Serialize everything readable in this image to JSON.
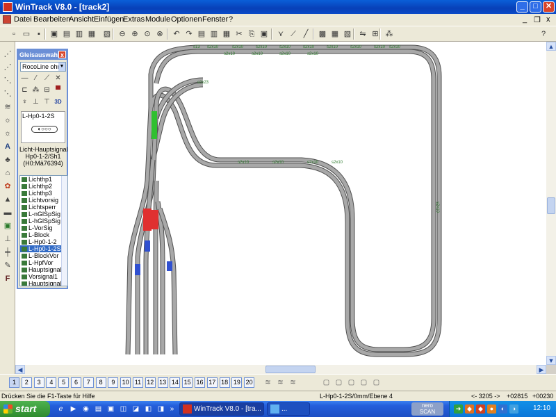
{
  "window": {
    "title": "WinTrack  V8.0 - [track2]",
    "minimize": "_",
    "maximize": "□",
    "close": "✕"
  },
  "menubar": {
    "items": [
      "Datei",
      "Bearbeiten",
      "Ansicht",
      "Einfügen",
      "Extras",
      "Module",
      "Optionen",
      "Fenster",
      "?"
    ],
    "mdi_minimize": "_",
    "mdi_restore": "❐",
    "mdi_close": "x"
  },
  "toolbar": {
    "buttons": [
      "new-icon",
      "open-icon",
      "save-icon",
      "print-preview-icon",
      "print-icon",
      "page-setup-icon",
      "calculator-icon",
      "landscape-icon",
      "zoom-out-icon",
      "zoom-in-icon",
      "zoom-fit-icon",
      "zoom-all-icon",
      "undo-icon",
      "redo-icon",
      "copy-page-icon",
      "align-icon",
      "grid-icon",
      "cut-icon",
      "copy-icon",
      "paste-icon",
      "split-icon",
      "curve-icon",
      "line-icon",
      "layer-icon",
      "color-icon",
      "color2-icon",
      "flip-icon",
      "bridge-icon",
      "signal-icon",
      "help-icon"
    ]
  },
  "palette": {
    "title": "Gleisauswahl",
    "close": "x",
    "manufacturer": "RocoLine ohne",
    "preview_label": "L-Hp0-1-2S",
    "preview_shape": "◐○○○",
    "description": [
      "Licht-Hauptsignal",
      "Hp0-1-2/Sh1",
      "(H0:Mä76394)"
    ],
    "signals": [
      "Lichthp1",
      "Lichthp2",
      "Lichthp3",
      "Lichtvorsig",
      "Lichtsperr",
      "L-nGlSpSig",
      "L-hGlSpSig",
      "L-VorSig",
      "L-Block",
      "L-Hp0-1-2",
      "L-Hp0-1-2S",
      "L-BlockVor",
      "L-HpfVor",
      "Hauptsignal1",
      "Vorsignal1",
      "Hauptsignal"
    ],
    "selected_index": 10
  },
  "track_labels": {
    "top": [
      "s13",
      "s2x10",
      "s2x10",
      "s2x10",
      "s2x10",
      "s2x10",
      "s2x10",
      "s2x10",
      "s2x10",
      "s2x10",
      "s2x10",
      "s2x10",
      "s2x10",
      "s2x10"
    ],
    "middle": [
      "s2x10",
      "s2x10",
      "s2x10",
      "s2x10",
      "s2x23"
    ],
    "right": [
      "s2x10"
    ]
  },
  "pages": [
    "1",
    "2",
    "3",
    "4",
    "5",
    "6",
    "7",
    "8",
    "9",
    "10",
    "11",
    "12",
    "13",
    "14",
    "15",
    "16",
    "17",
    "18",
    "19",
    "20"
  ],
  "status": {
    "help": "Drücken Sie die  F1-Taste für Hilfe",
    "item": "L-Hp0-1-2S/0mm/Ebene 4",
    "pos1": "<- 3205 ->",
    "pos2": "+02815",
    "pos3": "+00230"
  },
  "taskbar": {
    "start": "start",
    "task_label": "WinTrack  V8.0 - [tra...",
    "task2_label": "...",
    "nero_line1": "nero",
    "nero_line2": "SCAN",
    "clock": "12:10",
    "chevron": "»"
  },
  "colors": {
    "track": "#a8a8a8",
    "track_border": "#505050",
    "label": "#2a7a2a",
    "switch_red": "#e03030",
    "switch_green": "#30c030",
    "signal_blue": "#3050d0"
  }
}
